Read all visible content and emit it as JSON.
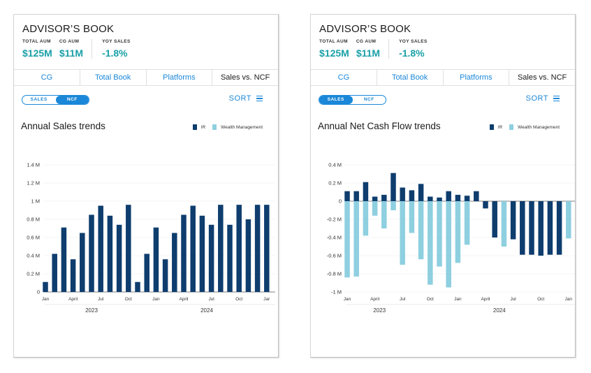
{
  "colors": {
    "accent": "#1aa0a8",
    "link": "#1a87d8",
    "ir": "#0e3d6e",
    "wealth": "#8ecfe0"
  },
  "cards": [
    {
      "title": "ADVISOR’S BOOK",
      "stats": [
        {
          "label": "TOTAL AUM",
          "value": "$125M"
        },
        {
          "label": "CG AUM",
          "value": "$11M"
        },
        {
          "label": "YOY SALES",
          "value": "-1.8%"
        }
      ],
      "tabs": [
        "CG",
        "Total Book",
        "Platforms",
        "Sales vs.  NCF"
      ],
      "active_tab": 3,
      "toggle": {
        "sales": "SALES",
        "ncf": "NCF",
        "selected": "ncf"
      },
      "sort_label": "SORT",
      "chart_title": "Annual Sales trends",
      "legend": {
        "ir": "IR",
        "wealth": "Wealth Management"
      }
    },
    {
      "title": "ADVISOR’S BOOK",
      "stats": [
        {
          "label": "TOTAL AUM",
          "value": "$125M"
        },
        {
          "label": "CG AUM",
          "value": "$11M"
        },
        {
          "label": "YOY SALES",
          "value": "-1.8%"
        }
      ],
      "tabs": [
        "CG",
        "Total Book",
        "Platforms",
        "Sales vs.  NCF"
      ],
      "active_tab": 3,
      "toggle": {
        "sales": "SALES",
        "ncf": "NCF",
        "selected": "sales"
      },
      "sort_label": "SORT",
      "chart_title": "Annual Net Cash Flow trends",
      "legend": {
        "ir": "IR",
        "wealth": "Wealth Management"
      }
    }
  ],
  "chart_data": [
    {
      "type": "bar",
      "title": "Annual Sales trends",
      "ylim": [
        0,
        1.4
      ],
      "yticks": [
        "0",
        "0.2 M",
        "0.4 M",
        "0.6 M",
        "0.8 M",
        "1 M",
        "1.2 M",
        "1.4 M"
      ],
      "ytick_values": [
        0,
        0.2,
        0.4,
        0.6,
        0.8,
        1.0,
        1.2,
        1.4
      ],
      "xtick_labels": [
        {
          "label": "Jan",
          "index": 0
        },
        {
          "label": "April",
          "index": 3
        },
        {
          "label": "Jul",
          "index": 6
        },
        {
          "label": "Oct",
          "index": 9
        },
        {
          "label": "Jan",
          "index": 12
        },
        {
          "label": "April",
          "index": 15
        },
        {
          "label": "Jul",
          "index": 18
        },
        {
          "label": "Oct",
          "index": 21
        },
        {
          "label": "Jar",
          "index": 24
        }
      ],
      "years": [
        {
          "label": "2023",
          "index": 5
        },
        {
          "label": "2024",
          "index": 17.5
        }
      ],
      "series": [
        {
          "name": "IR",
          "values": [
            0.11,
            0.42,
            0.71,
            0.36,
            0.65,
            0.85,
            0.95,
            0.84,
            0.74,
            0.96,
            0.11,
            0.42,
            0.71,
            0.36,
            0.65,
            0.85,
            0.95,
            0.84,
            0.74,
            0.96,
            0.74,
            0.96,
            0.8,
            0.96,
            0.96
          ]
        }
      ],
      "grid": true,
      "legend_position": "top-right"
    },
    {
      "type": "bar",
      "title": "Annual Net Cash Flow trends",
      "ylim": [
        -1,
        0.4
      ],
      "yticks": [
        "-1 M",
        "-0.8 M",
        "-0.6 M",
        "-0.4 M",
        "-0.2 M",
        "0",
        "0.2 M",
        "0.4 M"
      ],
      "ytick_values": [
        -1,
        -0.8,
        -0.6,
        -0.4,
        -0.2,
        0,
        0.2,
        0.4
      ],
      "xtick_labels": [
        {
          "label": "Jan",
          "index": 0
        },
        {
          "label": "April",
          "index": 3
        },
        {
          "label": "Jul",
          "index": 6
        },
        {
          "label": "Oct",
          "index": 9
        },
        {
          "label": "Jan",
          "index": 12
        },
        {
          "label": "April",
          "index": 15
        },
        {
          "label": "Jul",
          "index": 18
        },
        {
          "label": "Oct",
          "index": 21
        },
        {
          "label": "Jan",
          "index": 24
        }
      ],
      "years": [
        {
          "label": "2023",
          "index": 3.5
        },
        {
          "label": "2024",
          "index": 16.5
        }
      ],
      "series": [
        {
          "name": "IR",
          "values": [
            0.11,
            0.11,
            0.21,
            0.05,
            0.07,
            0.31,
            0.15,
            0.12,
            0.19,
            0.05,
            0.04,
            0.11,
            0.07,
            0.06,
            0.11,
            -0.08,
            -0.4,
            null,
            -0.42,
            -0.59,
            -0.59,
            -0.6,
            -0.59,
            -0.59,
            null
          ]
        },
        {
          "name": "Wealth Management",
          "values": [
            -0.84,
            -0.83,
            -0.38,
            -0.16,
            -0.3,
            -0.1,
            -0.7,
            -0.35,
            -0.64,
            -0.92,
            -0.72,
            -0.95,
            -0.68,
            -0.48,
            null,
            null,
            null,
            -0.5,
            null,
            null,
            null,
            null,
            null,
            null,
            -0.41
          ]
        }
      ],
      "grid": true,
      "legend_position": "top-right"
    }
  ]
}
